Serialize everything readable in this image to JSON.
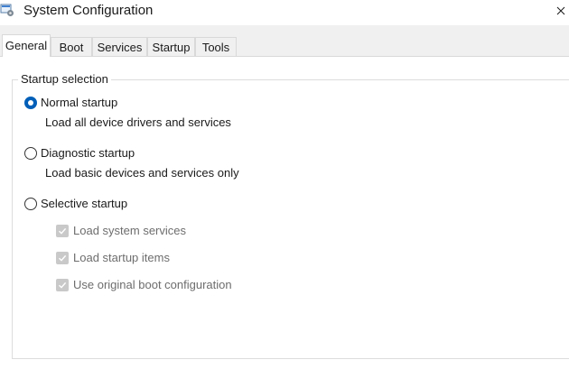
{
  "window": {
    "title": "System Configuration"
  },
  "tabs": [
    {
      "label": "General",
      "active": true
    },
    {
      "label": "Boot",
      "active": false
    },
    {
      "label": "Services",
      "active": false
    },
    {
      "label": "Startup",
      "active": false
    },
    {
      "label": "Tools",
      "active": false
    }
  ],
  "startup_selection": {
    "legend": "Startup selection",
    "options": [
      {
        "label": "Normal startup",
        "description": "Load all device drivers and services",
        "selected": true
      },
      {
        "label": "Diagnostic startup",
        "description": "Load basic devices and services only",
        "selected": false
      },
      {
        "label": "Selective startup",
        "selected": false
      }
    ],
    "selective_items": [
      {
        "label": "Load system services",
        "checked": true,
        "enabled": false
      },
      {
        "label": "Load startup items",
        "checked": true,
        "enabled": false
      },
      {
        "label": "Use original boot configuration",
        "checked": true,
        "enabled": false
      }
    ]
  },
  "colors": {
    "accent": "#005fb8",
    "disabled_text": "#6d6d6d",
    "disabled_check": "#c9c9c9"
  },
  "icons": {
    "app": "system-configuration-icon",
    "close": "close-icon",
    "check": "checkmark-icon"
  }
}
